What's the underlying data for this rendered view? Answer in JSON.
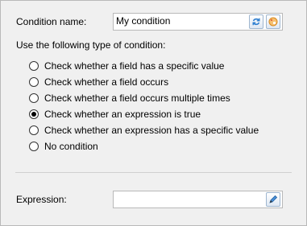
{
  "condition": {
    "name_label": "Condition name:",
    "name_value": "My condition",
    "refresh_icon": "refresh-icon",
    "palette_icon": "palette-icon"
  },
  "type_heading": "Use the following type of condition:",
  "options": [
    {
      "label": "Check whether a field has a specific value",
      "checked": false
    },
    {
      "label": "Check whether a field occurs",
      "checked": false
    },
    {
      "label": "Check whether a field occurs multiple times",
      "checked": false
    },
    {
      "label": "Check whether an expression is true",
      "checked": true
    },
    {
      "label": "Check whether an expression has a specific value",
      "checked": false
    },
    {
      "label": "No condition",
      "checked": false
    }
  ],
  "expression": {
    "label": "Expression:",
    "value": "",
    "edit_icon": "pencil-icon"
  },
  "colors": {
    "background": "#f0f0f0",
    "border": "#b9b9b9",
    "icon_blue": "#2f7fd0",
    "icon_orange": "#f0a030"
  }
}
